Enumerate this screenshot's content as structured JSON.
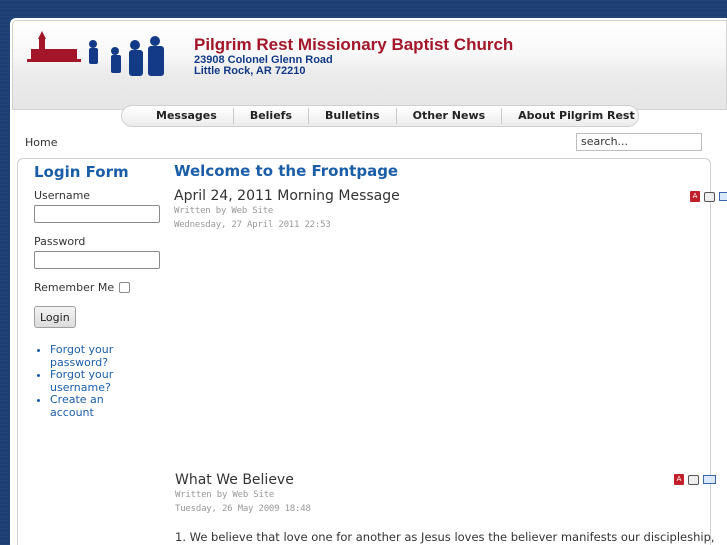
{
  "site": {
    "title": "Pilgrim Rest Missionary Baptist Church",
    "address_line1": "23908 Colonel Glenn Road",
    "address_line2": "Little Rock, AR  72210",
    "colors": {
      "title": "#a3162a",
      "address": "#123a86",
      "link": "#1b5ea8",
      "background": "#1d3f74"
    }
  },
  "nav": {
    "items": [
      {
        "label": "Messages"
      },
      {
        "label": "Beliefs"
      },
      {
        "label": "Bulletins"
      },
      {
        "label": "Other News"
      },
      {
        "label": "About Pilgrim Rest"
      }
    ]
  },
  "breadcrumb": "Home",
  "search": {
    "value": "search..."
  },
  "login": {
    "title": "Login Form",
    "username_label": "Username",
    "password_label": "Password",
    "remember_label": "Remember Me",
    "button": "Login",
    "links": [
      "Forgot your password?",
      "Forgot your username?",
      "Create an account"
    ]
  },
  "main": {
    "title": "Welcome to the Frontpage",
    "articles": [
      {
        "title": "April 24, 2011 Morning Message",
        "author": "Written by Web Site",
        "date": "Wednesday, 27 April 2011 22:53"
      },
      {
        "title": "What We Believe",
        "author": "Written by Web Site",
        "date": "Tuesday, 26 May 2009 18:48",
        "body": "1. We believe that love one for another as Jesus loves the believer manifests our discipleship,"
      }
    ],
    "icons": [
      "pdf-icon",
      "print-icon",
      "email-icon"
    ]
  }
}
